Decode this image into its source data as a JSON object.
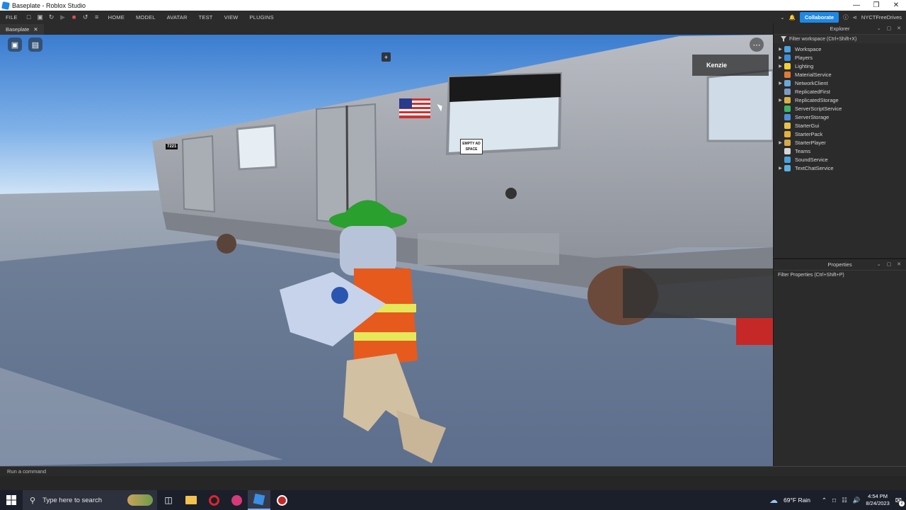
{
  "window": {
    "title": "Baseplate - Roblox Studio"
  },
  "ribbon": {
    "menus": [
      "FILE",
      "HOME",
      "MODEL",
      "AVATAR",
      "TEST",
      "VIEW",
      "PLUGINS"
    ],
    "collaborate_label": "Collaborate",
    "user": "NYCTFreeDrives"
  },
  "doc_tab": {
    "label": "Baseplate"
  },
  "viewport": {
    "player_tag": "Kenzie",
    "sign_text": [
      "EMPTY AD",
      "SPACE"
    ],
    "car_number": "7221"
  },
  "explorer": {
    "title": "Explorer",
    "filter_placeholder": "Filter workspace (Ctrl+Shift+X)",
    "items": [
      {
        "label": "Workspace",
        "expandable": true,
        "color": "#4aa3df"
      },
      {
        "label": "Players",
        "expandable": true,
        "color": "#3c8dde"
      },
      {
        "label": "Lighting",
        "expandable": true,
        "color": "#f2d035"
      },
      {
        "label": "MaterialService",
        "expandable": false,
        "color": "#e07a3a"
      },
      {
        "label": "NetworkClient",
        "expandable": true,
        "color": "#6aa8d8"
      },
      {
        "label": "ReplicatedFirst",
        "expandable": false,
        "color": "#7e9ac4"
      },
      {
        "label": "ReplicatedStorage",
        "expandable": true,
        "color": "#d9b34a"
      },
      {
        "label": "ServerScriptService",
        "expandable": false,
        "color": "#3fb56a"
      },
      {
        "label": "ServerStorage",
        "expandable": false,
        "color": "#4f8ed9"
      },
      {
        "label": "StarterGui",
        "expandable": false,
        "color": "#e6c24a"
      },
      {
        "label": "StarterPack",
        "expandable": false,
        "color": "#e3b13c"
      },
      {
        "label": "StarterPlayer",
        "expandable": true,
        "color": "#d4a94a"
      },
      {
        "label": "Teams",
        "expandable": false,
        "color": "#d6d6d6"
      },
      {
        "label": "SoundService",
        "expandable": false,
        "color": "#4aa0d8"
      },
      {
        "label": "TextChatService",
        "expandable": true,
        "color": "#5bb0e0"
      }
    ]
  },
  "properties": {
    "title": "Properties",
    "filter_placeholder": "Filter Properties (Ctrl+Shift+P)"
  },
  "command_bar": {
    "placeholder": "Run a command"
  },
  "taskbar": {
    "search_placeholder": "Type here to search",
    "weather": "69°F  Rain",
    "time": "4:54 PM",
    "date": "8/24/2023",
    "notification_count": "2"
  }
}
